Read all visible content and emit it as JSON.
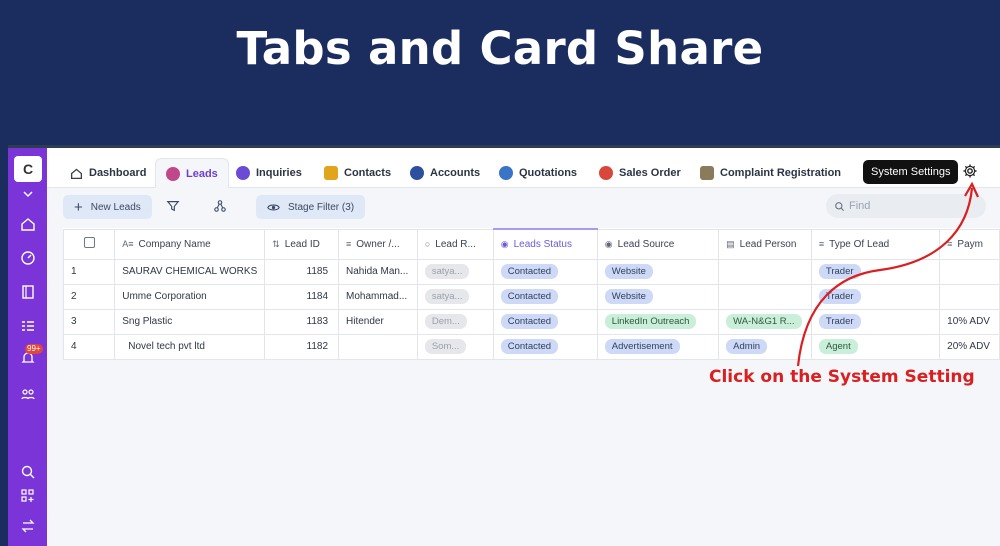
{
  "banner": {
    "title": "Tabs and Card Share"
  },
  "sidebar": {
    "logo": "C",
    "badge": "99+",
    "icons": [
      "chevron-down-icon",
      "home-icon",
      "dashboard-gauge-icon",
      "book-icon",
      "list-icon",
      "bell-icon",
      "team-icon",
      "search-icon",
      "apps-add-icon",
      "swap-icon"
    ]
  },
  "tabs": [
    {
      "label": "Dashboard",
      "icon": "home-icon",
      "color": "#3a3f4a"
    },
    {
      "label": "Leads",
      "icon": "leads-icon",
      "color": "#c0478a",
      "active": true
    },
    {
      "label": "Inquiries",
      "icon": "inquiries-icon",
      "color": "#6a4bd6"
    },
    {
      "label": "Contacts",
      "icon": "contacts-icon",
      "color": "#e0a51a"
    },
    {
      "label": "Accounts",
      "icon": "accounts-icon",
      "color": "#2d4f9e"
    },
    {
      "label": "Quotations",
      "icon": "quotations-icon",
      "color": "#3a74c7"
    },
    {
      "label": "Sales Order",
      "icon": "sales-order-icon",
      "color": "#d9463b"
    },
    {
      "label": "Complaint Registration",
      "icon": "complaint-icon",
      "color": "#8a7b5a"
    }
  ],
  "tooltip": "System Settings",
  "toolbar": {
    "new_label": "New Leads",
    "stage_filter": "Stage Filter (3)",
    "find_placeholder": "Find"
  },
  "table": {
    "headers": [
      "Company Name",
      "Lead ID",
      "Owner /...",
      "Lead R...",
      "Leads Status",
      "Lead Source",
      "Lead Person",
      "Type Of Lead",
      "Paym"
    ],
    "rows": [
      {
        "n": "1",
        "company": "SAURAV CHEMICAL WORKS",
        "id": "1185",
        "owner": "Nahida Man...",
        "lead_r": "satya...",
        "status": "Contacted",
        "source": "Website",
        "person": "",
        "type": "Trader",
        "pay": ""
      },
      {
        "n": "2",
        "company": "Umme Corporation",
        "id": "1184",
        "owner": "Mohammad...",
        "lead_r": "satya...",
        "status": "Contacted",
        "source": "Website",
        "person": "",
        "type": "Trader",
        "pay": ""
      },
      {
        "n": "3",
        "company": "Sng Plastic",
        "id": "1183",
        "owner": "Hitender",
        "lead_r": "Dem...",
        "status": "Contacted",
        "source": "LinkedIn Outreach",
        "person": "WA-N&G1 R...",
        "type": "Trader",
        "pay": "10% ADV"
      },
      {
        "n": "4",
        "company": "Novel tech pvt ltd",
        "id": "1182",
        "owner": "",
        "lead_r": "Som...",
        "status": "Contacted",
        "source": "Advertisement",
        "person": "Admin",
        "type": "Agent",
        "pay": "20% ADV"
      }
    ]
  },
  "annotation": {
    "text": "Click on the System Setting",
    "color": "#d92020"
  }
}
